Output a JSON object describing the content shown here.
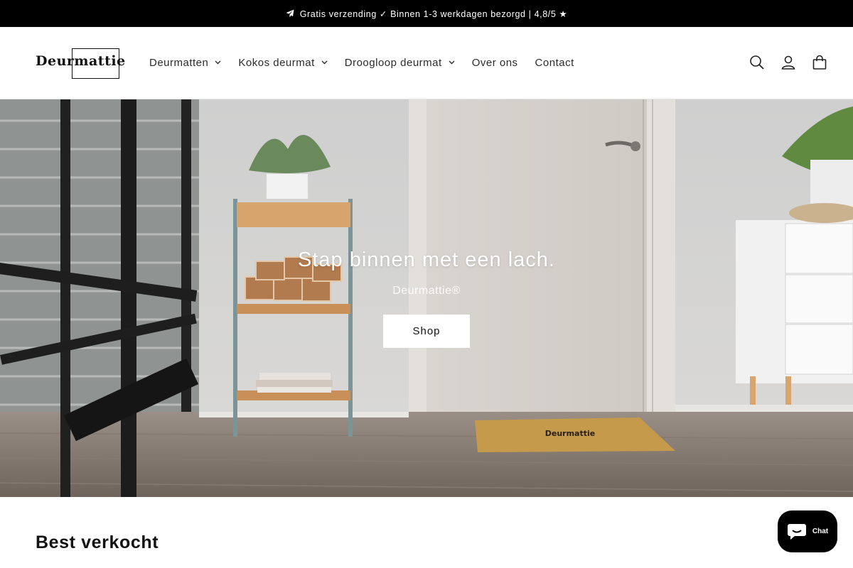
{
  "announcement": {
    "text": "Gratis verzending ✓ Binnen 1-3 werkdagen bezorgd | 4,8/5 ★",
    "icon": "paper-plane-icon"
  },
  "header": {
    "logo_text": "Deurmattie",
    "nav": [
      {
        "label": "Deurmatten",
        "dropdown": true
      },
      {
        "label": "Kokos deurmat",
        "dropdown": true
      },
      {
        "label": "Droogloop deurmat",
        "dropdown": true
      },
      {
        "label": "Over ons",
        "dropdown": false
      },
      {
        "label": "Contact",
        "dropdown": false
      }
    ],
    "icons": [
      "search-icon",
      "account-icon",
      "cart-icon"
    ]
  },
  "hero": {
    "title": "Stap binnen met een lach.",
    "subtitle": "Deurmattie®",
    "button_label": "Shop",
    "mat_text": "Deurmattie"
  },
  "sections": {
    "best_sellers_title": "Best verkocht"
  },
  "chat": {
    "label": "Chat",
    "icon": "chat-bubble-icon"
  },
  "colors": {
    "announcement_bg": "#000000",
    "chat_bg": "#000000",
    "button_bg": "#ffffff"
  }
}
